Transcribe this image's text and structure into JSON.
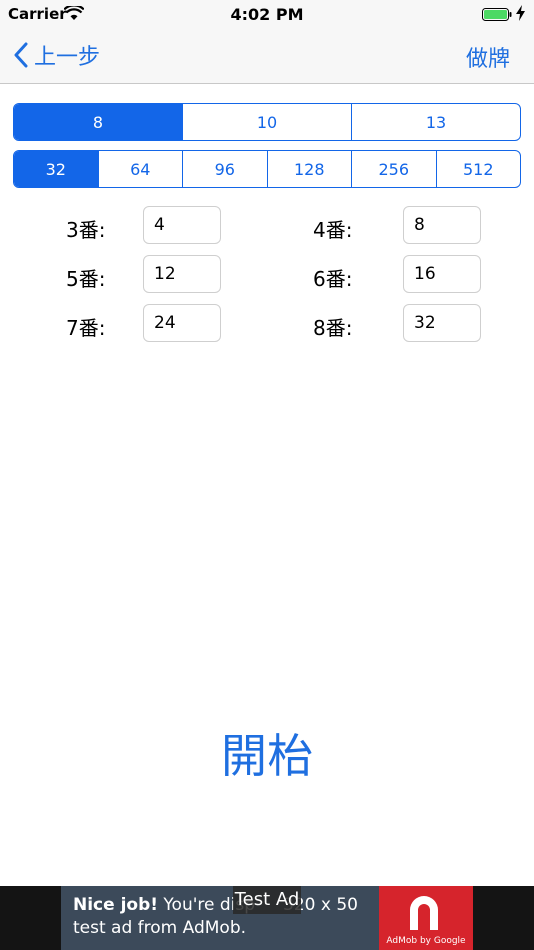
{
  "status_bar": {
    "carrier": "Carrier",
    "time": "4:02 PM"
  },
  "nav": {
    "back_label": "上一步",
    "right_label": "做牌"
  },
  "max_fan_segment": {
    "options": [
      "8",
      "10",
      "13"
    ],
    "selected": "8"
  },
  "base_segment": {
    "options": [
      "32",
      "64",
      "96",
      "128",
      "256",
      "512"
    ],
    "selected": "32"
  },
  "scores": [
    {
      "label": "3番:",
      "value": "4"
    },
    {
      "label": "4番:",
      "value": "8"
    },
    {
      "label": "5番:",
      "value": "12"
    },
    {
      "label": "6番:",
      "value": "16"
    },
    {
      "label": "7番:",
      "value": "24"
    },
    {
      "label": "8番:",
      "value": "32"
    }
  ],
  "start_label": "開枱",
  "ad": {
    "headline": "Nice job!",
    "body_line1": " You're disp",
    "body_suffix": "320 x 50",
    "body_line2": "test ad from AdMob.",
    "badge": "Test Ad",
    "logo_text": "AdMob by Google"
  },
  "colors": {
    "accent": "#1366e8",
    "ad_logo": "#d6242c"
  }
}
